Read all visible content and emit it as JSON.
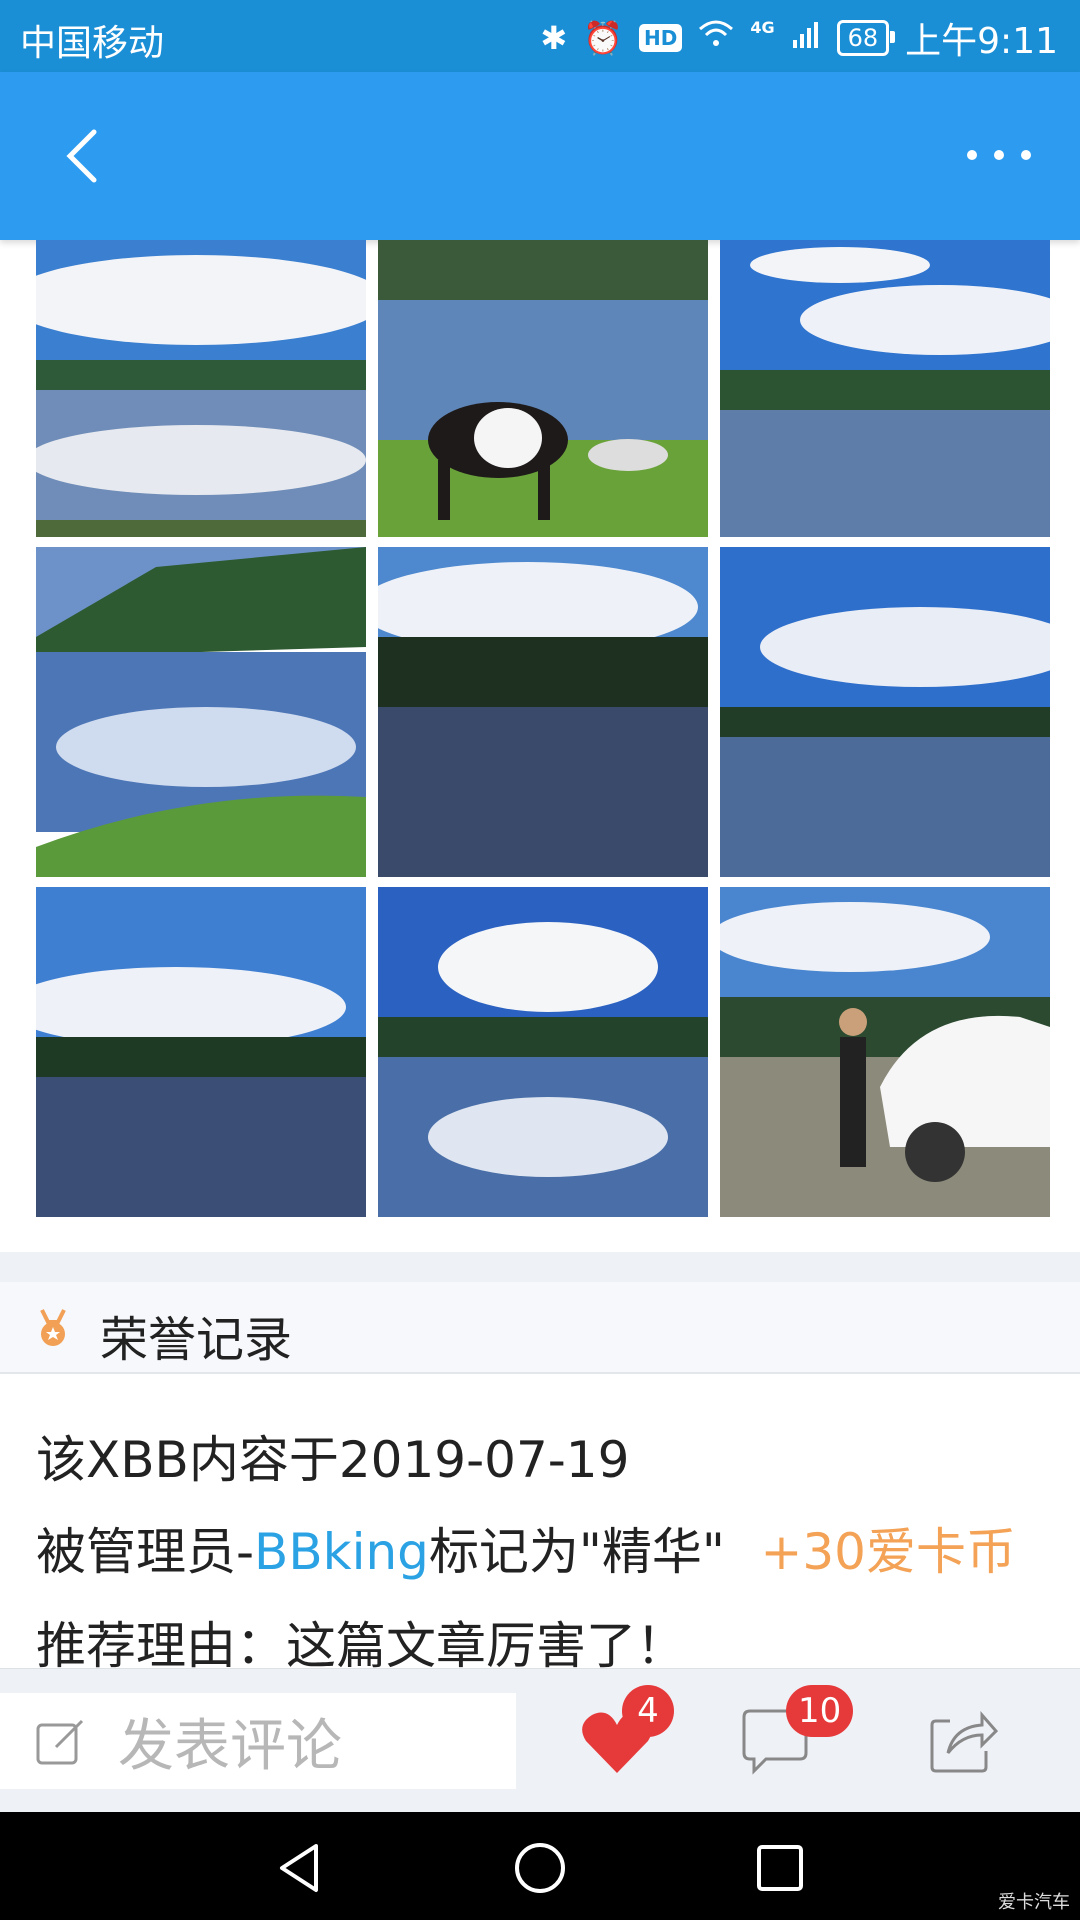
{
  "status_bar": {
    "carrier": "中国移动",
    "network": "4G",
    "battery": "68",
    "time": "上午9:11",
    "icons": [
      "bluetooth-icon",
      "alarm-icon",
      "hd-icon",
      "wifi-icon",
      "signal-icon",
      "battery-icon"
    ]
  },
  "nav": {
    "back_icon": "chevron-left-icon",
    "more_icon": "more-dots-icon"
  },
  "photos": [
    {
      "name": "lake-reflection-1"
    },
    {
      "name": "black-white-cow"
    },
    {
      "name": "lake-reflection-2"
    },
    {
      "name": "green-hill-lake"
    },
    {
      "name": "dark-lake-trees"
    },
    {
      "name": "monastery-lake"
    },
    {
      "name": "rippled-lake"
    },
    {
      "name": "cloud-reflection-lake"
    },
    {
      "name": "man-with-white-suv"
    }
  ],
  "honor": {
    "title": "荣誉记录",
    "line1": "该XBB内容于2019-07-19",
    "line2_prefix": "被管理员-",
    "moderator": "BBking",
    "line2_suffix": "标记为\"精华\"",
    "reward": "+30爱卡币",
    "line3": "推荐理由：这篇文章厉害了！"
  },
  "actions": {
    "comment_placeholder": "发表评论",
    "likes": "4",
    "comments": "10"
  },
  "watermark": "爱卡汽车",
  "colors": {
    "header": "#2d9cf0",
    "status": "#1b8fd6",
    "accent_blue": "#2aa2e4",
    "reward_orange": "#f3a256",
    "badge_red": "#e63a3a",
    "heart_red": "#e63a3a"
  }
}
